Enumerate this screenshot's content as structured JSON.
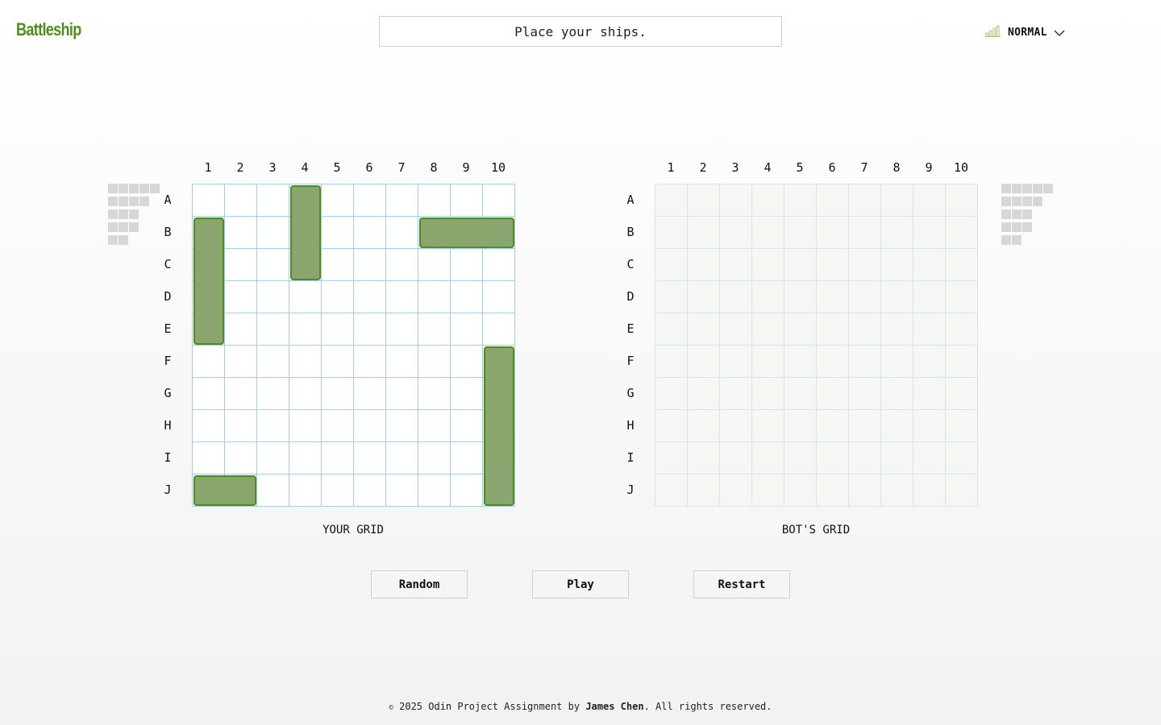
{
  "app": {
    "title": "Battleship"
  },
  "status_message": "Place your ships.",
  "difficulty": {
    "selected": "NORMAL",
    "icon": "signal-bars-icon"
  },
  "columns": [
    "1",
    "2",
    "3",
    "4",
    "5",
    "6",
    "7",
    "8",
    "9",
    "10"
  ],
  "rows": [
    "A",
    "B",
    "C",
    "D",
    "E",
    "F",
    "G",
    "H",
    "I",
    "J"
  ],
  "player_grid": {
    "title": "YOUR GRID",
    "ships": [
      {
        "name": "ship-length-4-vertical",
        "start": "B1",
        "length": 4,
        "orientation": "vertical"
      },
      {
        "name": "ship-length-3-vertical",
        "start": "A4",
        "length": 3,
        "orientation": "vertical"
      },
      {
        "name": "ship-length-3-horizontal",
        "start": "B8",
        "length": 3,
        "orientation": "horizontal"
      },
      {
        "name": "ship-length-5-vertical",
        "start": "F10",
        "length": 5,
        "orientation": "vertical"
      },
      {
        "name": "ship-length-2-horizontal",
        "start": "J1",
        "length": 2,
        "orientation": "horizontal"
      }
    ],
    "fleet_status": [
      5,
      4,
      3,
      3,
      2
    ]
  },
  "bot_grid": {
    "title": "BOT'S GRID",
    "fleet_status": [
      5,
      4,
      3,
      3,
      2
    ]
  },
  "buttons": {
    "random": "Random",
    "play": "Play",
    "restart": "Restart"
  },
  "footer": {
    "copyright_symbol": "©",
    "text_before": " 2025 Odin Project Assignment by ",
    "author": "James Chen",
    "text_after": ". All rights reserved."
  },
  "colors": {
    "brand": "#4e8d1c",
    "ship_fill": "#8aa56e",
    "grid_line": "#9fd0ea"
  }
}
